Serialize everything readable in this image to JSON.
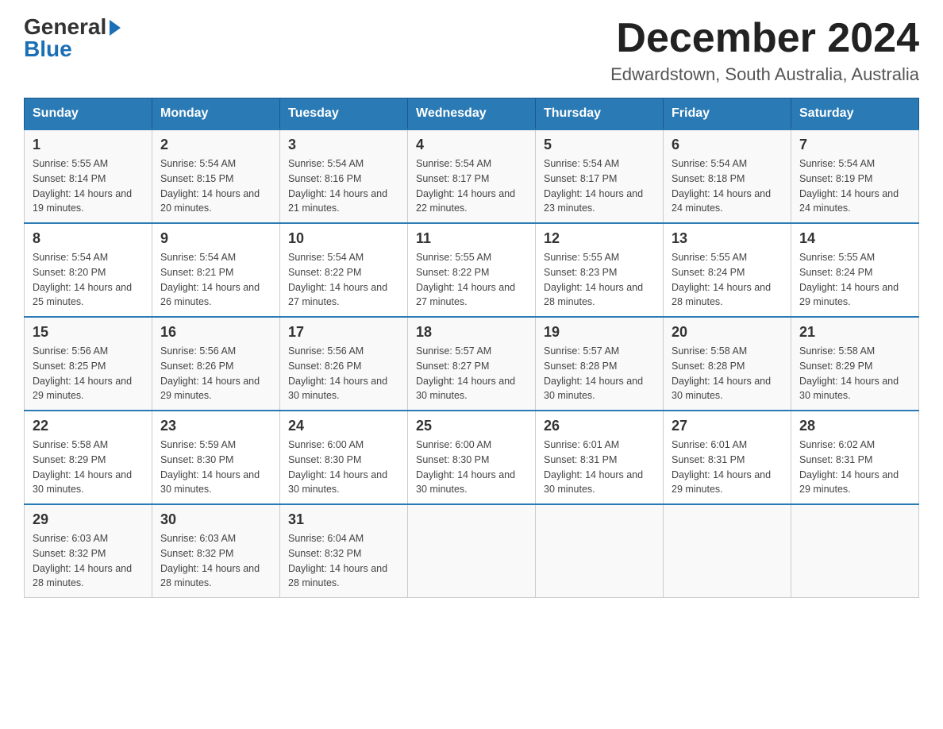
{
  "header": {
    "logo_general": "General",
    "logo_blue": "Blue",
    "month_title": "December 2024",
    "location": "Edwardstown, South Australia, Australia"
  },
  "days_of_week": [
    "Sunday",
    "Monday",
    "Tuesday",
    "Wednesday",
    "Thursday",
    "Friday",
    "Saturday"
  ],
  "weeks": [
    [
      {
        "day": "1",
        "sunrise": "5:55 AM",
        "sunset": "8:14 PM",
        "daylight": "14 hours and 19 minutes."
      },
      {
        "day": "2",
        "sunrise": "5:54 AM",
        "sunset": "8:15 PM",
        "daylight": "14 hours and 20 minutes."
      },
      {
        "day": "3",
        "sunrise": "5:54 AM",
        "sunset": "8:16 PM",
        "daylight": "14 hours and 21 minutes."
      },
      {
        "day": "4",
        "sunrise": "5:54 AM",
        "sunset": "8:17 PM",
        "daylight": "14 hours and 22 minutes."
      },
      {
        "day": "5",
        "sunrise": "5:54 AM",
        "sunset": "8:17 PM",
        "daylight": "14 hours and 23 minutes."
      },
      {
        "day": "6",
        "sunrise": "5:54 AM",
        "sunset": "8:18 PM",
        "daylight": "14 hours and 24 minutes."
      },
      {
        "day": "7",
        "sunrise": "5:54 AM",
        "sunset": "8:19 PM",
        "daylight": "14 hours and 24 minutes."
      }
    ],
    [
      {
        "day": "8",
        "sunrise": "5:54 AM",
        "sunset": "8:20 PM",
        "daylight": "14 hours and 25 minutes."
      },
      {
        "day": "9",
        "sunrise": "5:54 AM",
        "sunset": "8:21 PM",
        "daylight": "14 hours and 26 minutes."
      },
      {
        "day": "10",
        "sunrise": "5:54 AM",
        "sunset": "8:22 PM",
        "daylight": "14 hours and 27 minutes."
      },
      {
        "day": "11",
        "sunrise": "5:55 AM",
        "sunset": "8:22 PM",
        "daylight": "14 hours and 27 minutes."
      },
      {
        "day": "12",
        "sunrise": "5:55 AM",
        "sunset": "8:23 PM",
        "daylight": "14 hours and 28 minutes."
      },
      {
        "day": "13",
        "sunrise": "5:55 AM",
        "sunset": "8:24 PM",
        "daylight": "14 hours and 28 minutes."
      },
      {
        "day": "14",
        "sunrise": "5:55 AM",
        "sunset": "8:24 PM",
        "daylight": "14 hours and 29 minutes."
      }
    ],
    [
      {
        "day": "15",
        "sunrise": "5:56 AM",
        "sunset": "8:25 PM",
        "daylight": "14 hours and 29 minutes."
      },
      {
        "day": "16",
        "sunrise": "5:56 AM",
        "sunset": "8:26 PM",
        "daylight": "14 hours and 29 minutes."
      },
      {
        "day": "17",
        "sunrise": "5:56 AM",
        "sunset": "8:26 PM",
        "daylight": "14 hours and 30 minutes."
      },
      {
        "day": "18",
        "sunrise": "5:57 AM",
        "sunset": "8:27 PM",
        "daylight": "14 hours and 30 minutes."
      },
      {
        "day": "19",
        "sunrise": "5:57 AM",
        "sunset": "8:28 PM",
        "daylight": "14 hours and 30 minutes."
      },
      {
        "day": "20",
        "sunrise": "5:58 AM",
        "sunset": "8:28 PM",
        "daylight": "14 hours and 30 minutes."
      },
      {
        "day": "21",
        "sunrise": "5:58 AM",
        "sunset": "8:29 PM",
        "daylight": "14 hours and 30 minutes."
      }
    ],
    [
      {
        "day": "22",
        "sunrise": "5:58 AM",
        "sunset": "8:29 PM",
        "daylight": "14 hours and 30 minutes."
      },
      {
        "day": "23",
        "sunrise": "5:59 AM",
        "sunset": "8:30 PM",
        "daylight": "14 hours and 30 minutes."
      },
      {
        "day": "24",
        "sunrise": "6:00 AM",
        "sunset": "8:30 PM",
        "daylight": "14 hours and 30 minutes."
      },
      {
        "day": "25",
        "sunrise": "6:00 AM",
        "sunset": "8:30 PM",
        "daylight": "14 hours and 30 minutes."
      },
      {
        "day": "26",
        "sunrise": "6:01 AM",
        "sunset": "8:31 PM",
        "daylight": "14 hours and 30 minutes."
      },
      {
        "day": "27",
        "sunrise": "6:01 AM",
        "sunset": "8:31 PM",
        "daylight": "14 hours and 29 minutes."
      },
      {
        "day": "28",
        "sunrise": "6:02 AM",
        "sunset": "8:31 PM",
        "daylight": "14 hours and 29 minutes."
      }
    ],
    [
      {
        "day": "29",
        "sunrise": "6:03 AM",
        "sunset": "8:32 PM",
        "daylight": "14 hours and 28 minutes."
      },
      {
        "day": "30",
        "sunrise": "6:03 AM",
        "sunset": "8:32 PM",
        "daylight": "14 hours and 28 minutes."
      },
      {
        "day": "31",
        "sunrise": "6:04 AM",
        "sunset": "8:32 PM",
        "daylight": "14 hours and 28 minutes."
      },
      null,
      null,
      null,
      null
    ]
  ]
}
